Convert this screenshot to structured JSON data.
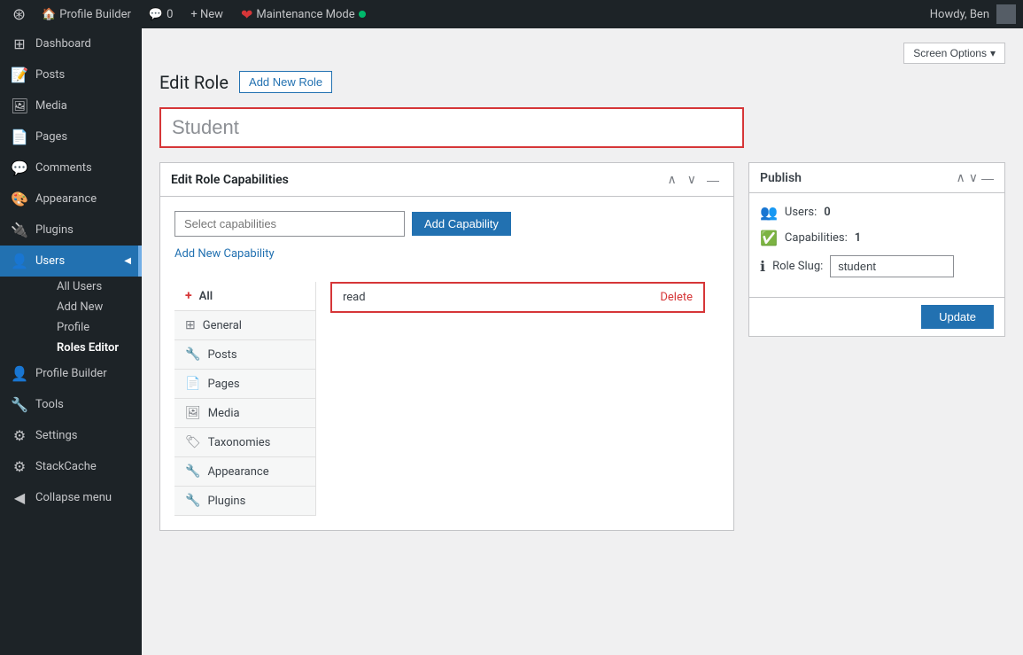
{
  "topbar": {
    "logo": "⊞",
    "site_name": "Profile Builder",
    "comments_icon": "💬",
    "comments_count": "0",
    "new_label": "+ New",
    "maintenance_label": "Maintenance Mode",
    "howdy_label": "Howdy, Ben"
  },
  "screen_options": {
    "label": "Screen Options",
    "arrow": "▾"
  },
  "page": {
    "title": "Edit Role",
    "add_new_role_btn": "Add New Role",
    "role_name_placeholder": "Student",
    "role_name_value": "Student"
  },
  "capabilities_box": {
    "title": "Edit Role Capabilities",
    "select_placeholder": "Select capabilities",
    "add_capability_btn": "Add Capability",
    "add_new_capability_link": "Add New Capability"
  },
  "categories": [
    {
      "id": "all",
      "label": "All",
      "icon": "+",
      "active": true
    },
    {
      "id": "general",
      "label": "General",
      "icon": "⊞"
    },
    {
      "id": "posts",
      "label": "Posts",
      "icon": "🔧"
    },
    {
      "id": "pages",
      "label": "Pages",
      "icon": "📄"
    },
    {
      "id": "media",
      "label": "Media",
      "icon": "🖼"
    },
    {
      "id": "taxonomies",
      "label": "Taxonomies",
      "icon": "🏷"
    },
    {
      "id": "appearance",
      "label": "Appearance",
      "icon": "🔧"
    },
    {
      "id": "plugins",
      "label": "Plugins",
      "icon": "🔧"
    }
  ],
  "capabilities_list": [
    {
      "name": "read",
      "delete_label": "Delete"
    }
  ],
  "publish_box": {
    "title": "Publish",
    "users_icon": "👥",
    "users_label": "Users:",
    "users_value": "0",
    "capabilities_icon": "✅",
    "capabilities_label": "Capabilities:",
    "capabilities_value": "1",
    "role_slug_icon": "ℹ",
    "role_slug_label": "Role Slug:",
    "role_slug_value": "student",
    "update_btn": "Update"
  },
  "sidebar": {
    "items": [
      {
        "id": "dashboard",
        "label": "Dashboard",
        "icon": "⊞"
      },
      {
        "id": "posts",
        "label": "Posts",
        "icon": "📝"
      },
      {
        "id": "media",
        "label": "Media",
        "icon": "🖼"
      },
      {
        "id": "pages",
        "label": "Pages",
        "icon": "📄"
      },
      {
        "id": "comments",
        "label": "Comments",
        "icon": "💬"
      },
      {
        "id": "appearance",
        "label": "Appearance",
        "icon": "🎨"
      },
      {
        "id": "plugins",
        "label": "Plugins",
        "icon": "🔌"
      },
      {
        "id": "users",
        "label": "Users",
        "icon": "👤",
        "active": true
      },
      {
        "id": "profile-builder",
        "label": "Profile Builder",
        "icon": "👤"
      },
      {
        "id": "tools",
        "label": "Tools",
        "icon": "🔧"
      },
      {
        "id": "settings",
        "label": "Settings",
        "icon": "⚙"
      },
      {
        "id": "stackcache",
        "label": "StackCache",
        "icon": "⚙"
      },
      {
        "id": "collapse",
        "label": "Collapse menu",
        "icon": "◀"
      }
    ],
    "users_subitems": [
      {
        "id": "all-users",
        "label": "All Users"
      },
      {
        "id": "add-new",
        "label": "Add New"
      },
      {
        "id": "profile",
        "label": "Profile"
      },
      {
        "id": "roles-editor",
        "label": "Roles Editor",
        "active": true
      }
    ]
  }
}
